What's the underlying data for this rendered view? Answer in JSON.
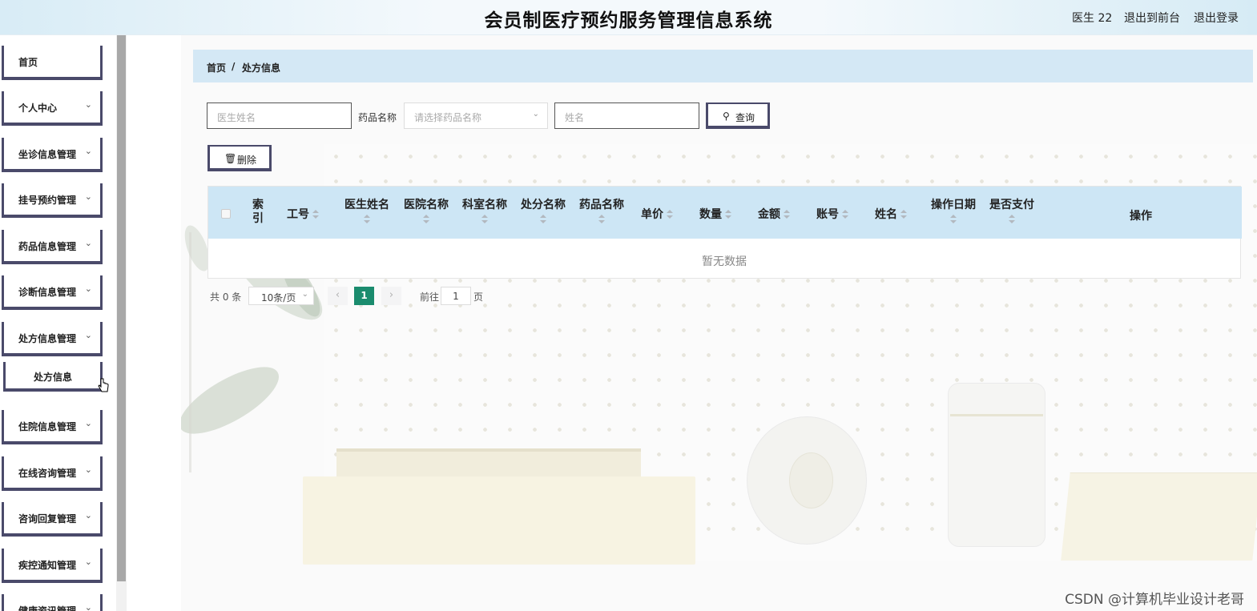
{
  "header": {
    "title": "会员制医疗预约服务管理信息系统",
    "user_label": "医生 22",
    "back_to_front": "退出到前台",
    "logout": "退出登录"
  },
  "sidebar": {
    "items": [
      {
        "label": "首页"
      },
      {
        "label": "个人中心"
      },
      {
        "label": "坐诊信息管理"
      },
      {
        "label": "挂号预约管理"
      },
      {
        "label": "药品信息管理"
      },
      {
        "label": "诊断信息管理"
      },
      {
        "label": "处方信息管理"
      },
      {
        "label": "住院信息管理"
      },
      {
        "label": "在线咨询管理"
      },
      {
        "label": "咨询回复管理"
      },
      {
        "label": "疾控通知管理"
      },
      {
        "label": "健康资讯管理"
      }
    ],
    "submenu": {
      "label": "处方信息"
    }
  },
  "breadcrumb": {
    "home": "首页",
    "separator": "/",
    "current": "处方信息"
  },
  "search": {
    "doctor_placeholder": "医生姓名",
    "drug_label": "药品名称",
    "drug_placeholder": "请选择药品名称",
    "name_placeholder": "姓名",
    "query_label": "查询"
  },
  "actions": {
    "delete_label": "删除"
  },
  "table": {
    "columns": {
      "index_line1": "索",
      "index_line2": "引",
      "job_no": "工号",
      "doctor_name": "医生姓名",
      "hospital_name": "医院名称",
      "dept_name": "科室名称",
      "prescription_name": "处分名称",
      "drug_name": "药品名称",
      "unit_price": "单价",
      "quantity": "数量",
      "amount": "金额",
      "account": "账号",
      "name": "姓名",
      "op_date": "操作日期",
      "paid": "是否支付",
      "operation": "操作"
    },
    "empty_text": "暂无数据"
  },
  "pagination": {
    "total": "共 0 条",
    "page_size": "10条/页",
    "current_page": "1",
    "goto_label": "前往",
    "goto_value": "1",
    "page_suffix": "页"
  },
  "watermark": "CSDN @计算机毕业设计老哥",
  "colors": {
    "accent": "#1b8c6e",
    "header_bar": "#cde6f5",
    "button_border": "#4a4a6a"
  }
}
